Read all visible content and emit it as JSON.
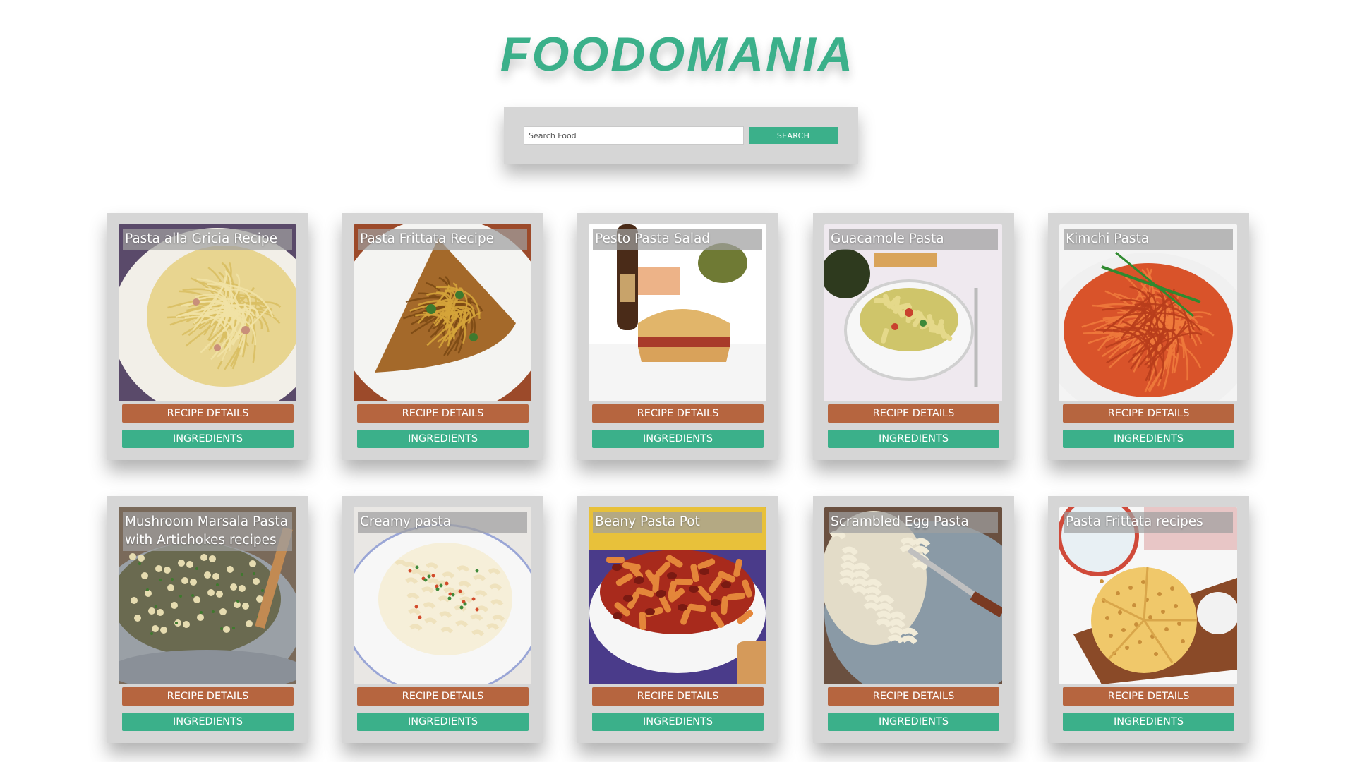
{
  "brand": {
    "title": "FOODOMANIA",
    "color": "#3bb08a"
  },
  "search": {
    "placeholder": "Search Food",
    "value": "",
    "button_label": "SEARCH"
  },
  "colors": {
    "recipe_button": "#b6653f",
    "ingredients_button": "#3bb08a",
    "card_bg": "#d6d6d6"
  },
  "recipes": [
    {
      "title": "Pasta alla Gricia Recipe",
      "recipe_label": "RECIPE DETAILS",
      "ingredients_label": "INGREDIENTS",
      "image": "spaghetti-plate"
    },
    {
      "title": "Pasta Frittata Recipe",
      "recipe_label": "RECIPE DETAILS",
      "ingredients_label": "INGREDIENTS",
      "image": "frittata-slice"
    },
    {
      "title": "Pesto Pasta Salad",
      "recipe_label": "RECIPE DETAILS",
      "ingredients_label": "INGREDIENTS",
      "image": "sandwich-beer"
    },
    {
      "title": "Guacamole Pasta",
      "recipe_label": "RECIPE DETAILS",
      "ingredients_label": "INGREDIENTS",
      "image": "penne-bowl"
    },
    {
      "title": "Kimchi Pasta",
      "recipe_label": "RECIPE DETAILS",
      "ingredients_label": "INGREDIENTS",
      "image": "red-spaghetti"
    },
    {
      "title": "Mushroom Marsala Pasta with Artichokes recipes",
      "recipe_label": "RECIPE DETAILS",
      "ingredients_label": "INGREDIENTS",
      "image": "pot-pasta"
    },
    {
      "title": "Creamy pasta",
      "recipe_label": "RECIPE DETAILS",
      "ingredients_label": "INGREDIENTS",
      "image": "mac-cheese"
    },
    {
      "title": "Beany Pasta Pot",
      "recipe_label": "RECIPE DETAILS",
      "ingredients_label": "INGREDIENTS",
      "image": "penne-tomato"
    },
    {
      "title": "Scrambled Egg Pasta",
      "recipe_label": "RECIPE DETAILS",
      "ingredients_label": "INGREDIENTS",
      "image": "egg-pasta-fork"
    },
    {
      "title": "Pasta Frittata recipes",
      "recipe_label": "RECIPE DETAILS",
      "ingredients_label": "INGREDIENTS",
      "image": "frittata-board"
    }
  ]
}
